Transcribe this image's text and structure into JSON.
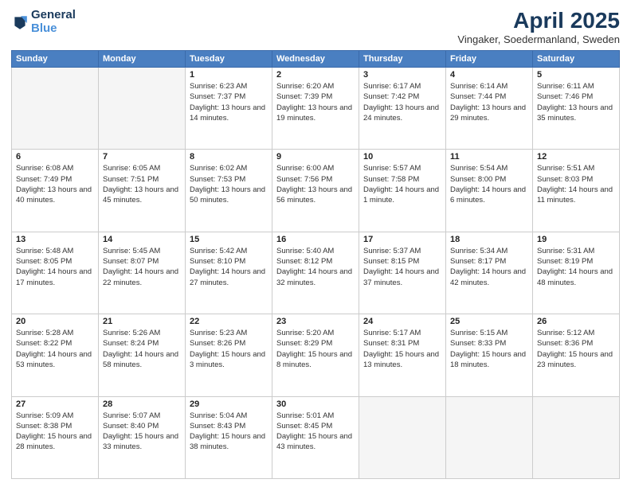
{
  "header": {
    "logo_line1": "General",
    "logo_line2": "Blue",
    "title": "April 2025",
    "subtitle": "Vingaker, Soedermanland, Sweden"
  },
  "days_of_week": [
    "Sunday",
    "Monday",
    "Tuesday",
    "Wednesday",
    "Thursday",
    "Friday",
    "Saturday"
  ],
  "weeks": [
    [
      {
        "num": "",
        "info": ""
      },
      {
        "num": "",
        "info": ""
      },
      {
        "num": "1",
        "info": "Sunrise: 6:23 AM\nSunset: 7:37 PM\nDaylight: 13 hours and 14 minutes."
      },
      {
        "num": "2",
        "info": "Sunrise: 6:20 AM\nSunset: 7:39 PM\nDaylight: 13 hours and 19 minutes."
      },
      {
        "num": "3",
        "info": "Sunrise: 6:17 AM\nSunset: 7:42 PM\nDaylight: 13 hours and 24 minutes."
      },
      {
        "num": "4",
        "info": "Sunrise: 6:14 AM\nSunset: 7:44 PM\nDaylight: 13 hours and 29 minutes."
      },
      {
        "num": "5",
        "info": "Sunrise: 6:11 AM\nSunset: 7:46 PM\nDaylight: 13 hours and 35 minutes."
      }
    ],
    [
      {
        "num": "6",
        "info": "Sunrise: 6:08 AM\nSunset: 7:49 PM\nDaylight: 13 hours and 40 minutes."
      },
      {
        "num": "7",
        "info": "Sunrise: 6:05 AM\nSunset: 7:51 PM\nDaylight: 13 hours and 45 minutes."
      },
      {
        "num": "8",
        "info": "Sunrise: 6:02 AM\nSunset: 7:53 PM\nDaylight: 13 hours and 50 minutes."
      },
      {
        "num": "9",
        "info": "Sunrise: 6:00 AM\nSunset: 7:56 PM\nDaylight: 13 hours and 56 minutes."
      },
      {
        "num": "10",
        "info": "Sunrise: 5:57 AM\nSunset: 7:58 PM\nDaylight: 14 hours and 1 minute."
      },
      {
        "num": "11",
        "info": "Sunrise: 5:54 AM\nSunset: 8:00 PM\nDaylight: 14 hours and 6 minutes."
      },
      {
        "num": "12",
        "info": "Sunrise: 5:51 AM\nSunset: 8:03 PM\nDaylight: 14 hours and 11 minutes."
      }
    ],
    [
      {
        "num": "13",
        "info": "Sunrise: 5:48 AM\nSunset: 8:05 PM\nDaylight: 14 hours and 17 minutes."
      },
      {
        "num": "14",
        "info": "Sunrise: 5:45 AM\nSunset: 8:07 PM\nDaylight: 14 hours and 22 minutes."
      },
      {
        "num": "15",
        "info": "Sunrise: 5:42 AM\nSunset: 8:10 PM\nDaylight: 14 hours and 27 minutes."
      },
      {
        "num": "16",
        "info": "Sunrise: 5:40 AM\nSunset: 8:12 PM\nDaylight: 14 hours and 32 minutes."
      },
      {
        "num": "17",
        "info": "Sunrise: 5:37 AM\nSunset: 8:15 PM\nDaylight: 14 hours and 37 minutes."
      },
      {
        "num": "18",
        "info": "Sunrise: 5:34 AM\nSunset: 8:17 PM\nDaylight: 14 hours and 42 minutes."
      },
      {
        "num": "19",
        "info": "Sunrise: 5:31 AM\nSunset: 8:19 PM\nDaylight: 14 hours and 48 minutes."
      }
    ],
    [
      {
        "num": "20",
        "info": "Sunrise: 5:28 AM\nSunset: 8:22 PM\nDaylight: 14 hours and 53 minutes."
      },
      {
        "num": "21",
        "info": "Sunrise: 5:26 AM\nSunset: 8:24 PM\nDaylight: 14 hours and 58 minutes."
      },
      {
        "num": "22",
        "info": "Sunrise: 5:23 AM\nSunset: 8:26 PM\nDaylight: 15 hours and 3 minutes."
      },
      {
        "num": "23",
        "info": "Sunrise: 5:20 AM\nSunset: 8:29 PM\nDaylight: 15 hours and 8 minutes."
      },
      {
        "num": "24",
        "info": "Sunrise: 5:17 AM\nSunset: 8:31 PM\nDaylight: 15 hours and 13 minutes."
      },
      {
        "num": "25",
        "info": "Sunrise: 5:15 AM\nSunset: 8:33 PM\nDaylight: 15 hours and 18 minutes."
      },
      {
        "num": "26",
        "info": "Sunrise: 5:12 AM\nSunset: 8:36 PM\nDaylight: 15 hours and 23 minutes."
      }
    ],
    [
      {
        "num": "27",
        "info": "Sunrise: 5:09 AM\nSunset: 8:38 PM\nDaylight: 15 hours and 28 minutes."
      },
      {
        "num": "28",
        "info": "Sunrise: 5:07 AM\nSunset: 8:40 PM\nDaylight: 15 hours and 33 minutes."
      },
      {
        "num": "29",
        "info": "Sunrise: 5:04 AM\nSunset: 8:43 PM\nDaylight: 15 hours and 38 minutes."
      },
      {
        "num": "30",
        "info": "Sunrise: 5:01 AM\nSunset: 8:45 PM\nDaylight: 15 hours and 43 minutes."
      },
      {
        "num": "",
        "info": ""
      },
      {
        "num": "",
        "info": ""
      },
      {
        "num": "",
        "info": ""
      }
    ]
  ]
}
